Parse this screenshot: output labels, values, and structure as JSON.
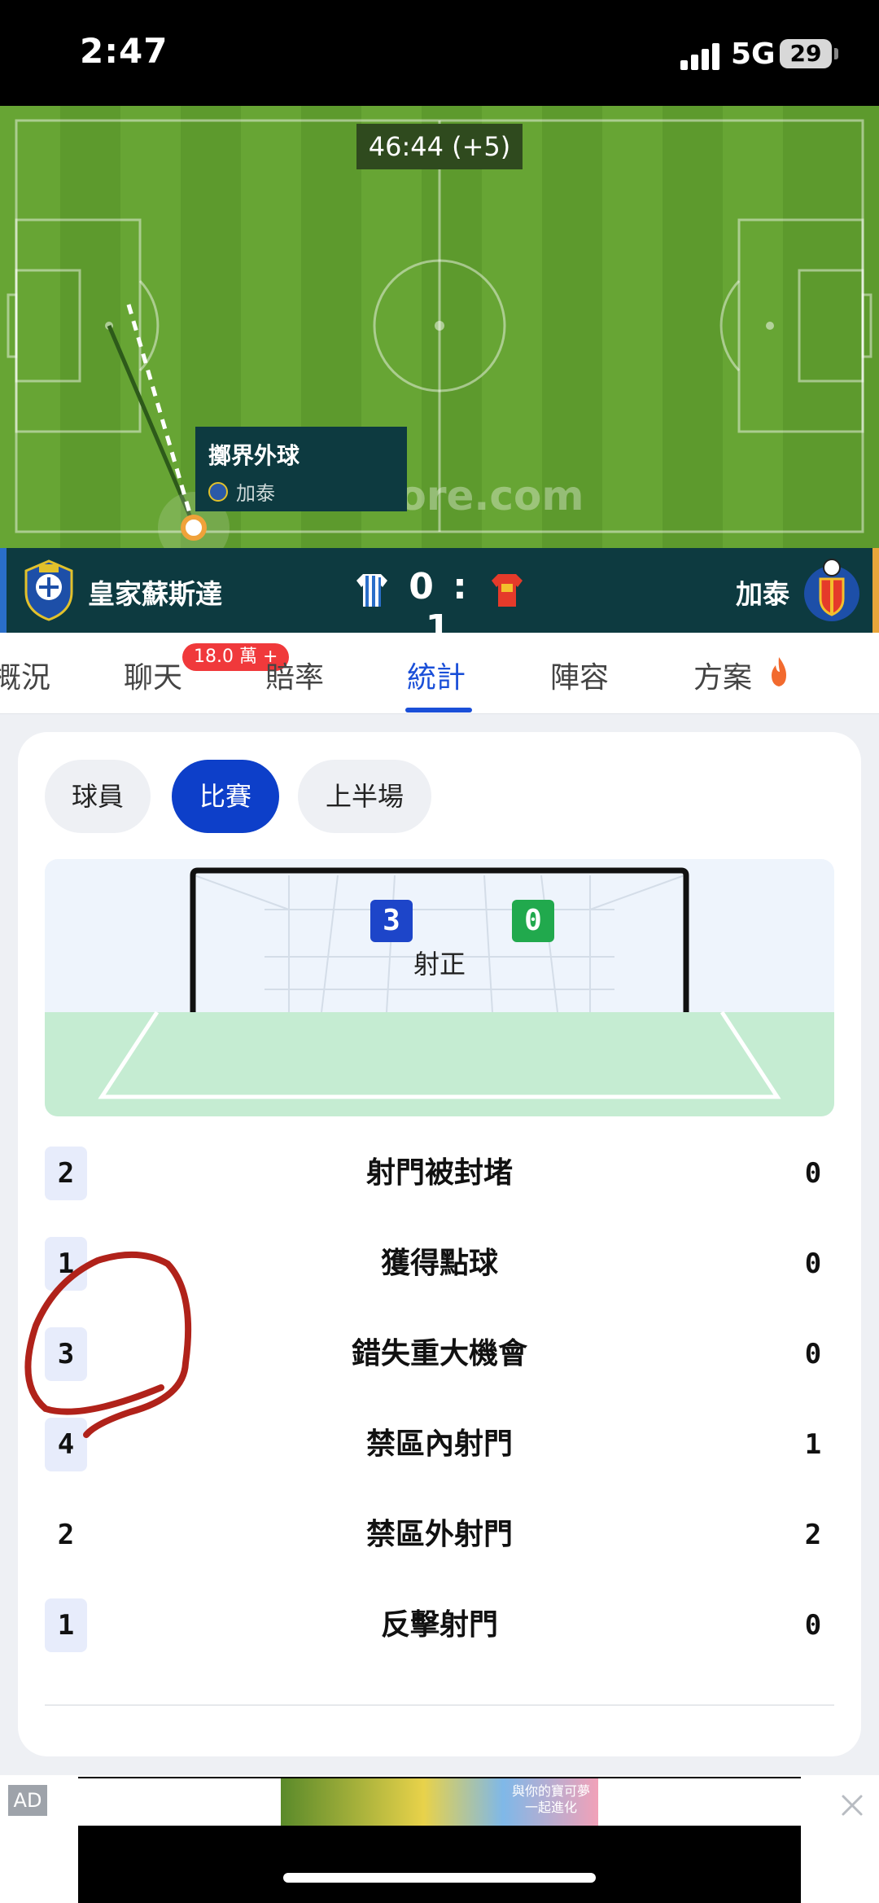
{
  "status_bar": {
    "time": "2:47",
    "network": "5G",
    "battery": "29"
  },
  "pitch": {
    "clock": "46:44 (+5)",
    "event_title": "擲界外球",
    "event_team": "加泰",
    "watermark": "AiScore.com"
  },
  "match": {
    "home_team": "皇家蘇斯達",
    "away_team": "加泰",
    "score": "0 : 1"
  },
  "tabs": [
    {
      "label": "概況"
    },
    {
      "label": "聊天"
    },
    {
      "label": "賠率"
    },
    {
      "label": "統計"
    },
    {
      "label": "陣容"
    },
    {
      "label": "方案"
    }
  ],
  "chat_badge": "18.0 萬 +",
  "filters": [
    {
      "label": "球員"
    },
    {
      "label": "比賽"
    },
    {
      "label": "上半場"
    }
  ],
  "shots_on_target": {
    "label": "射正",
    "home": "3",
    "away": "0"
  },
  "stats": [
    {
      "name": "射門被封堵",
      "home": "2",
      "away": "0"
    },
    {
      "name": "獲得點球",
      "home": "1",
      "away": "0"
    },
    {
      "name": "錯失重大機會",
      "home": "3",
      "away": "0"
    },
    {
      "name": "禁區內射門",
      "home": "4",
      "away": "1"
    },
    {
      "name": "禁區外射門",
      "home": "2",
      "away": "2"
    },
    {
      "name": "反擊射門",
      "home": "1",
      "away": "0"
    }
  ],
  "ad": {
    "label": "AD",
    "banner_text_1": "與你的寶可夢",
    "banner_text_2": "一起進化"
  },
  "colors": {
    "accent": "#1a4fd8",
    "pitch": "#5d9a2d",
    "scorebar": "#0d3a40",
    "annotation": "#b0221a"
  }
}
